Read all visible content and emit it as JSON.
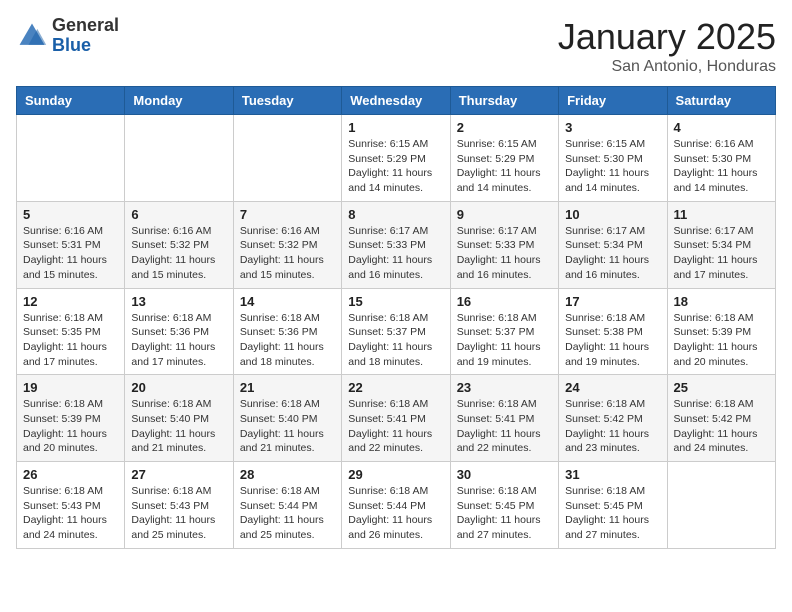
{
  "header": {
    "logo_general": "General",
    "logo_blue": "Blue",
    "month_title": "January 2025",
    "location": "San Antonio, Honduras"
  },
  "days_of_week": [
    "Sunday",
    "Monday",
    "Tuesday",
    "Wednesday",
    "Thursday",
    "Friday",
    "Saturday"
  ],
  "weeks": [
    [
      {
        "day": "",
        "info": ""
      },
      {
        "day": "",
        "info": ""
      },
      {
        "day": "",
        "info": ""
      },
      {
        "day": "1",
        "info": "Sunrise: 6:15 AM\nSunset: 5:29 PM\nDaylight: 11 hours\nand 14 minutes."
      },
      {
        "day": "2",
        "info": "Sunrise: 6:15 AM\nSunset: 5:29 PM\nDaylight: 11 hours\nand 14 minutes."
      },
      {
        "day": "3",
        "info": "Sunrise: 6:15 AM\nSunset: 5:30 PM\nDaylight: 11 hours\nand 14 minutes."
      },
      {
        "day": "4",
        "info": "Sunrise: 6:16 AM\nSunset: 5:30 PM\nDaylight: 11 hours\nand 14 minutes."
      }
    ],
    [
      {
        "day": "5",
        "info": "Sunrise: 6:16 AM\nSunset: 5:31 PM\nDaylight: 11 hours\nand 15 minutes."
      },
      {
        "day": "6",
        "info": "Sunrise: 6:16 AM\nSunset: 5:32 PM\nDaylight: 11 hours\nand 15 minutes."
      },
      {
        "day": "7",
        "info": "Sunrise: 6:16 AM\nSunset: 5:32 PM\nDaylight: 11 hours\nand 15 minutes."
      },
      {
        "day": "8",
        "info": "Sunrise: 6:17 AM\nSunset: 5:33 PM\nDaylight: 11 hours\nand 16 minutes."
      },
      {
        "day": "9",
        "info": "Sunrise: 6:17 AM\nSunset: 5:33 PM\nDaylight: 11 hours\nand 16 minutes."
      },
      {
        "day": "10",
        "info": "Sunrise: 6:17 AM\nSunset: 5:34 PM\nDaylight: 11 hours\nand 16 minutes."
      },
      {
        "day": "11",
        "info": "Sunrise: 6:17 AM\nSunset: 5:34 PM\nDaylight: 11 hours\nand 17 minutes."
      }
    ],
    [
      {
        "day": "12",
        "info": "Sunrise: 6:18 AM\nSunset: 5:35 PM\nDaylight: 11 hours\nand 17 minutes."
      },
      {
        "day": "13",
        "info": "Sunrise: 6:18 AM\nSunset: 5:36 PM\nDaylight: 11 hours\nand 17 minutes."
      },
      {
        "day": "14",
        "info": "Sunrise: 6:18 AM\nSunset: 5:36 PM\nDaylight: 11 hours\nand 18 minutes."
      },
      {
        "day": "15",
        "info": "Sunrise: 6:18 AM\nSunset: 5:37 PM\nDaylight: 11 hours\nand 18 minutes."
      },
      {
        "day": "16",
        "info": "Sunrise: 6:18 AM\nSunset: 5:37 PM\nDaylight: 11 hours\nand 19 minutes."
      },
      {
        "day": "17",
        "info": "Sunrise: 6:18 AM\nSunset: 5:38 PM\nDaylight: 11 hours\nand 19 minutes."
      },
      {
        "day": "18",
        "info": "Sunrise: 6:18 AM\nSunset: 5:39 PM\nDaylight: 11 hours\nand 20 minutes."
      }
    ],
    [
      {
        "day": "19",
        "info": "Sunrise: 6:18 AM\nSunset: 5:39 PM\nDaylight: 11 hours\nand 20 minutes."
      },
      {
        "day": "20",
        "info": "Sunrise: 6:18 AM\nSunset: 5:40 PM\nDaylight: 11 hours\nand 21 minutes."
      },
      {
        "day": "21",
        "info": "Sunrise: 6:18 AM\nSunset: 5:40 PM\nDaylight: 11 hours\nand 21 minutes."
      },
      {
        "day": "22",
        "info": "Sunrise: 6:18 AM\nSunset: 5:41 PM\nDaylight: 11 hours\nand 22 minutes."
      },
      {
        "day": "23",
        "info": "Sunrise: 6:18 AM\nSunset: 5:41 PM\nDaylight: 11 hours\nand 22 minutes."
      },
      {
        "day": "24",
        "info": "Sunrise: 6:18 AM\nSunset: 5:42 PM\nDaylight: 11 hours\nand 23 minutes."
      },
      {
        "day": "25",
        "info": "Sunrise: 6:18 AM\nSunset: 5:42 PM\nDaylight: 11 hours\nand 24 minutes."
      }
    ],
    [
      {
        "day": "26",
        "info": "Sunrise: 6:18 AM\nSunset: 5:43 PM\nDaylight: 11 hours\nand 24 minutes."
      },
      {
        "day": "27",
        "info": "Sunrise: 6:18 AM\nSunset: 5:43 PM\nDaylight: 11 hours\nand 25 minutes."
      },
      {
        "day": "28",
        "info": "Sunrise: 6:18 AM\nSunset: 5:44 PM\nDaylight: 11 hours\nand 25 minutes."
      },
      {
        "day": "29",
        "info": "Sunrise: 6:18 AM\nSunset: 5:44 PM\nDaylight: 11 hours\nand 26 minutes."
      },
      {
        "day": "30",
        "info": "Sunrise: 6:18 AM\nSunset: 5:45 PM\nDaylight: 11 hours\nand 27 minutes."
      },
      {
        "day": "31",
        "info": "Sunrise: 6:18 AM\nSunset: 5:45 PM\nDaylight: 11 hours\nand 27 minutes."
      },
      {
        "day": "",
        "info": ""
      }
    ]
  ]
}
